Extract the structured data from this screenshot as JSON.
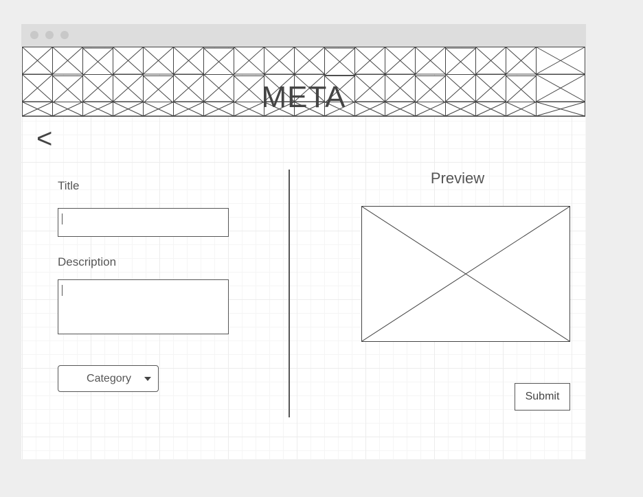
{
  "header": {
    "title": "META"
  },
  "nav": {
    "back_glyph": "<",
    "back_icon": "chevron-left-icon"
  },
  "form": {
    "title_label": "Title",
    "title_value": "",
    "description_label": "Description",
    "description_value": "",
    "category_label": "Category"
  },
  "preview": {
    "title": "Preview"
  },
  "actions": {
    "submit_label": "Submit"
  },
  "colors": {
    "window_bg": "#ffffff",
    "titlebar": "#dddddd",
    "page_bg": "#eeeeee",
    "stroke": "#444444"
  }
}
